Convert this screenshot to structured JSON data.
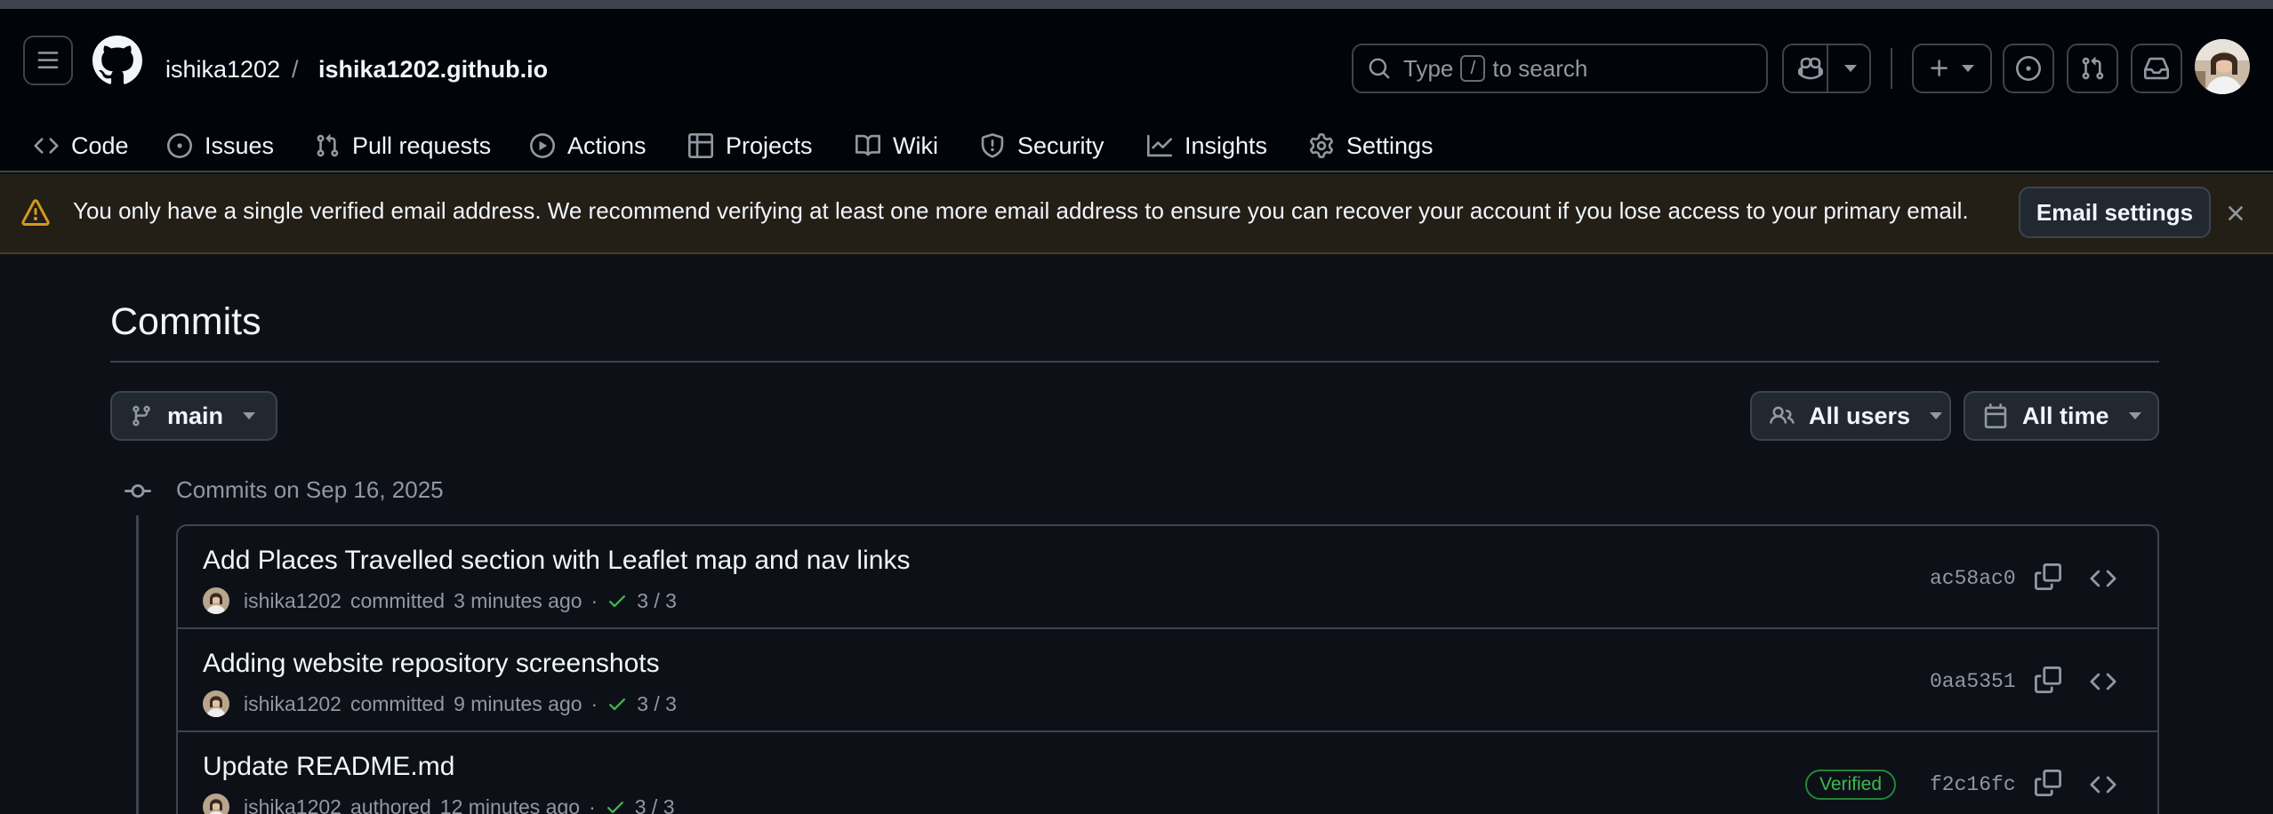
{
  "header": {
    "owner": "ishika1202",
    "separator": "/",
    "repo": "ishika1202.github.io",
    "search_prefix": "Type",
    "search_key": "/",
    "search_suffix": "to search"
  },
  "repo_nav": [
    {
      "label": "Code",
      "icon": "code-icon"
    },
    {
      "label": "Issues",
      "icon": "issue-opened-icon"
    },
    {
      "label": "Pull requests",
      "icon": "git-pull-request-icon"
    },
    {
      "label": "Actions",
      "icon": "play-icon"
    },
    {
      "label": "Projects",
      "icon": "table-icon"
    },
    {
      "label": "Wiki",
      "icon": "book-icon"
    },
    {
      "label": "Security",
      "icon": "shield-icon"
    },
    {
      "label": "Insights",
      "icon": "graph-icon"
    },
    {
      "label": "Settings",
      "icon": "gear-icon"
    }
  ],
  "banner": {
    "text": "You only have a single verified email address. We recommend verifying at least one more email address to ensure you can recover your account if you lose access to your primary email.",
    "button": "Email settings"
  },
  "page": {
    "title": "Commits",
    "branch": "main",
    "users_filter": "All users",
    "time_filter": "All time"
  },
  "commit_group": {
    "heading": "Commits on Sep 16, 2025",
    "commits": [
      {
        "message": "Add Places Travelled section with Leaflet map and nav links",
        "author": "ishika1202",
        "action": "committed",
        "time": "3 minutes ago",
        "checks": "3 / 3",
        "sha": "ac58ac0",
        "verified": ""
      },
      {
        "message": "Adding website repository screenshots",
        "author": "ishika1202",
        "action": "committed",
        "time": "9 minutes ago",
        "checks": "3 / 3",
        "sha": "0aa5351",
        "verified": ""
      },
      {
        "message": "Update README.md",
        "author": "ishika1202",
        "action": "authored",
        "time": "12 minutes ago",
        "checks": "3 / 3",
        "sha": "f2c16fc",
        "verified": "Verified"
      }
    ]
  },
  "colors": {
    "background": "#0d1117",
    "header": "#010409",
    "border": "#3d444d",
    "muted_text": "#9198a1",
    "success": "#3fb950",
    "warning": "#d29922"
  }
}
